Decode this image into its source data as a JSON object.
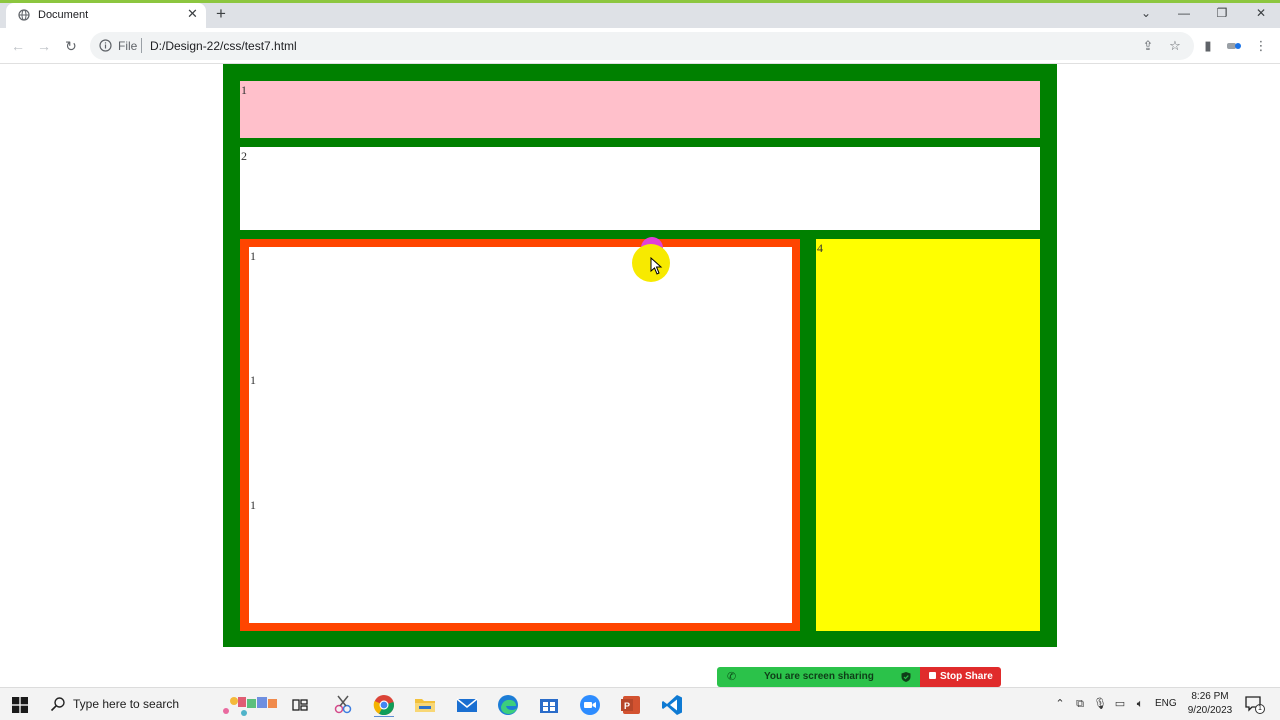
{
  "browser": {
    "tab": {
      "title": "Document",
      "close_icon": "close-icon"
    },
    "new_tab_label": "+",
    "window_controls": {
      "dropdown": "⌄",
      "minimize": "—",
      "maximize": "❐",
      "close": "✕"
    },
    "address": {
      "scheme_label": "File",
      "url": "D:/Design-22/css/test7.html"
    }
  },
  "page": {
    "boxes": {
      "pink": "1",
      "white": "2",
      "orange_items": [
        "1",
        "1",
        "1"
      ],
      "yellow": "4"
    },
    "colors": {
      "outer_frame": "#008000",
      "pink_box": "#ffc0cb",
      "orange_border": "#ff4500",
      "yellow_box": "#ffff00",
      "cursor_highlight": "#f7ea00"
    }
  },
  "screen_share": {
    "status": "You are screen sharing",
    "stop_label": "Stop Share"
  },
  "taskbar": {
    "search_placeholder": "Type here to search",
    "language": "ENG",
    "time": "8:26 PM",
    "date": "9/20/2023",
    "notification_count": "1"
  }
}
